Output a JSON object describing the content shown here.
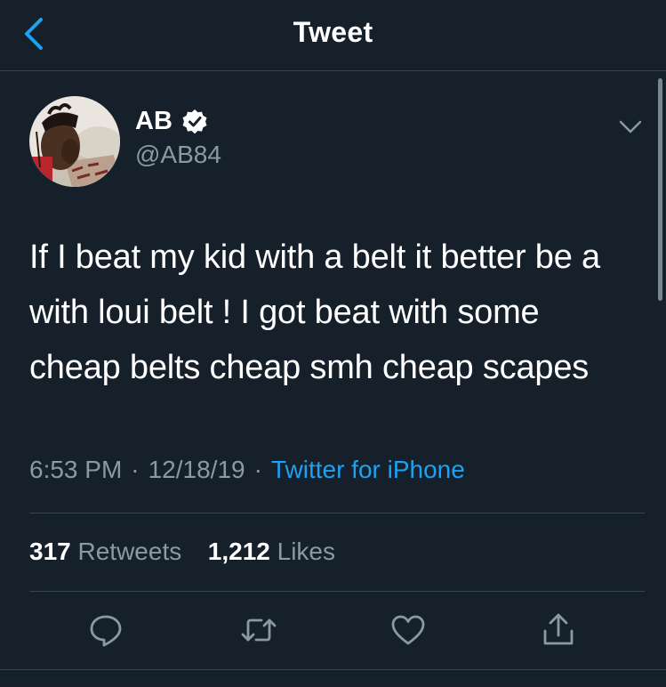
{
  "header": {
    "title": "Tweet"
  },
  "tweet": {
    "author_name": "AB",
    "author_handle": "@AB84",
    "text_lines": [
      "If I beat my kid with a belt it better be a",
      "with loui belt ! I got beat with some",
      "cheap belts cheap smh cheap scapes"
    ],
    "time": "6:53 PM",
    "separator": "·",
    "date": "12/18/19",
    "source": "Twitter for iPhone"
  },
  "stats": {
    "retweets_count": "317",
    "retweets_label": "Retweets",
    "likes_count": "1,212",
    "likes_label": "Likes"
  },
  "colors": {
    "background": "#15202b",
    "accent": "#1da1f2",
    "secondary_text": "#8b98a5",
    "divider": "#38444d"
  },
  "icons": {
    "back": "chevron-left-icon",
    "verified": "verified-badge-icon",
    "more": "chevron-down-icon",
    "reply": "reply-icon",
    "retweet": "retweet-icon",
    "like": "heart-icon",
    "share": "share-icon"
  }
}
